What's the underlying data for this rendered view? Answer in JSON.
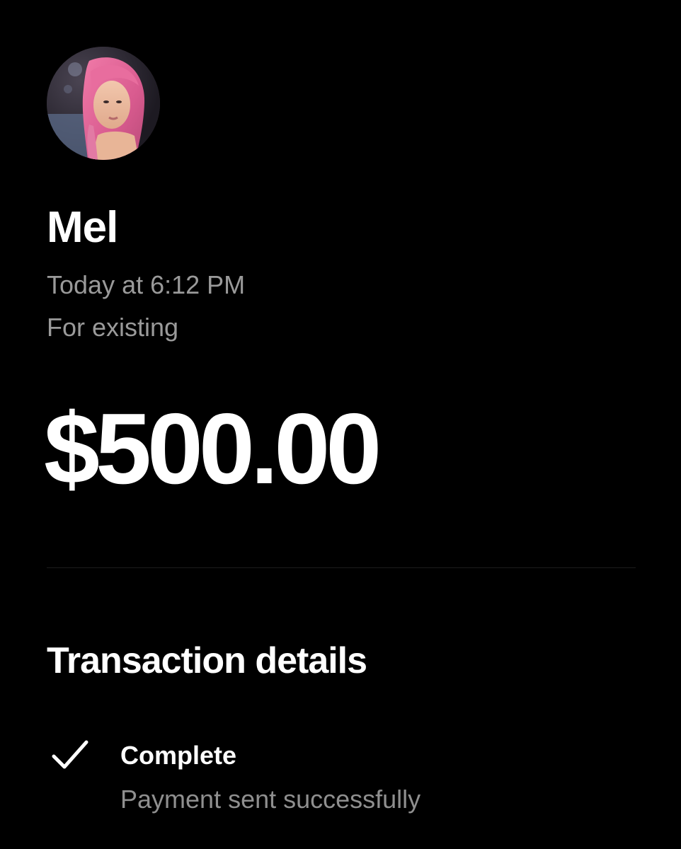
{
  "recipient": {
    "name": "Mel",
    "avatar_icon": "profile-photo"
  },
  "payment": {
    "time": "Today at 6:12 PM",
    "note": "For existing",
    "amount": "$500.00"
  },
  "details": {
    "title": "Transaction details",
    "status_icon": "check-icon",
    "status": "Complete",
    "status_description": "Payment sent successfully"
  },
  "colors": {
    "background": "#000000",
    "primary_text": "#ffffff",
    "secondary_text": "#9a9a9a"
  }
}
